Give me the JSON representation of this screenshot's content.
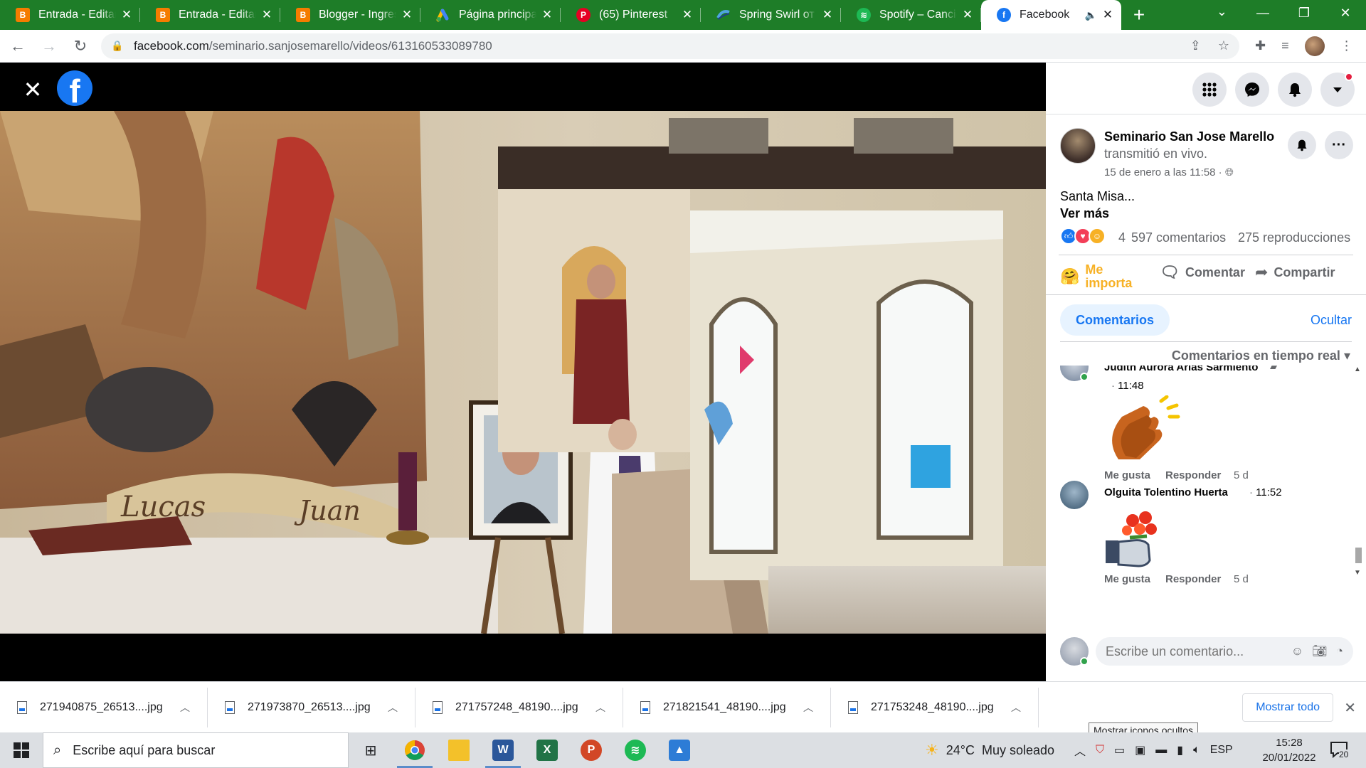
{
  "browser": {
    "tabs": [
      {
        "title": "Entrada - Editar",
        "favicon": "blogger-icon",
        "active": false
      },
      {
        "title": "Entrada - Editar",
        "favicon": "blogger-icon",
        "active": false
      },
      {
        "title": "Blogger - Ingreso",
        "favicon": "blogger-icon",
        "active": false
      },
      {
        "title": "Página principal - ",
        "favicon": "google-ads-icon",
        "active": false
      },
      {
        "title": "(65) Pinterest",
        "favicon": "pinterest-icon",
        "active": false
      },
      {
        "title": "Spring Swirl от Sa",
        "favicon": "swirl-icon",
        "active": false
      },
      {
        "title": "Spotify – Cancion",
        "favicon": "spotify-icon",
        "active": false
      },
      {
        "title": "Facebook",
        "favicon": "facebook-icon",
        "active": true
      }
    ],
    "url_host": "facebook.com",
    "url_path": "/seminario.sanjosemarello/videos/613160533089780",
    "accent_color": "#1e7d28"
  },
  "viewer": {
    "logo_letter": "f"
  },
  "post": {
    "author": "Seminario San Jose Marello",
    "action": "transmitió en vivo.",
    "time": "15 de enero a las 11:58 · ",
    "text": "Santa Misa...",
    "see_more": "Ver más",
    "reaction_count": "4",
    "comments_count": "597 comentarios",
    "views_count": "275 reproducciones",
    "actions": {
      "react": "Me importa",
      "comment": "Comentar",
      "share": "Compartir"
    }
  },
  "comments": {
    "tab_label": "Comentarios",
    "hide_label": "Ocultar",
    "sort_label": "Comentarios en tiempo real",
    "items": [
      {
        "name": "Judith Aurora Arias Sarmiento",
        "time": "11:48",
        "like": "Me gusta",
        "reply": "Responder",
        "age": "5 d"
      },
      {
        "name": "Olguita Tolentino Huerta",
        "time": "11:52",
        "like": "Me gusta",
        "reply": "Responder",
        "age": "5 d"
      }
    ],
    "composer_placeholder": "Escribe un comentario..."
  },
  "downloads": {
    "items": [
      "271940875_26513....jpg",
      "271973870_26513....jpg",
      "271757248_48190....jpg",
      "271821541_48190....jpg",
      "271753248_48190....jpg"
    ],
    "show_all": "Mostrar todo",
    "tooltip": "Mostrar iconos ocultos"
  },
  "taskbar": {
    "search_placeholder": "Escribe aquí para buscar",
    "weather_temp": "24°C",
    "weather_desc": "Muy soleado",
    "language": "ESP",
    "time": "15:28",
    "date": "20/01/2022",
    "notification_count": "20"
  }
}
